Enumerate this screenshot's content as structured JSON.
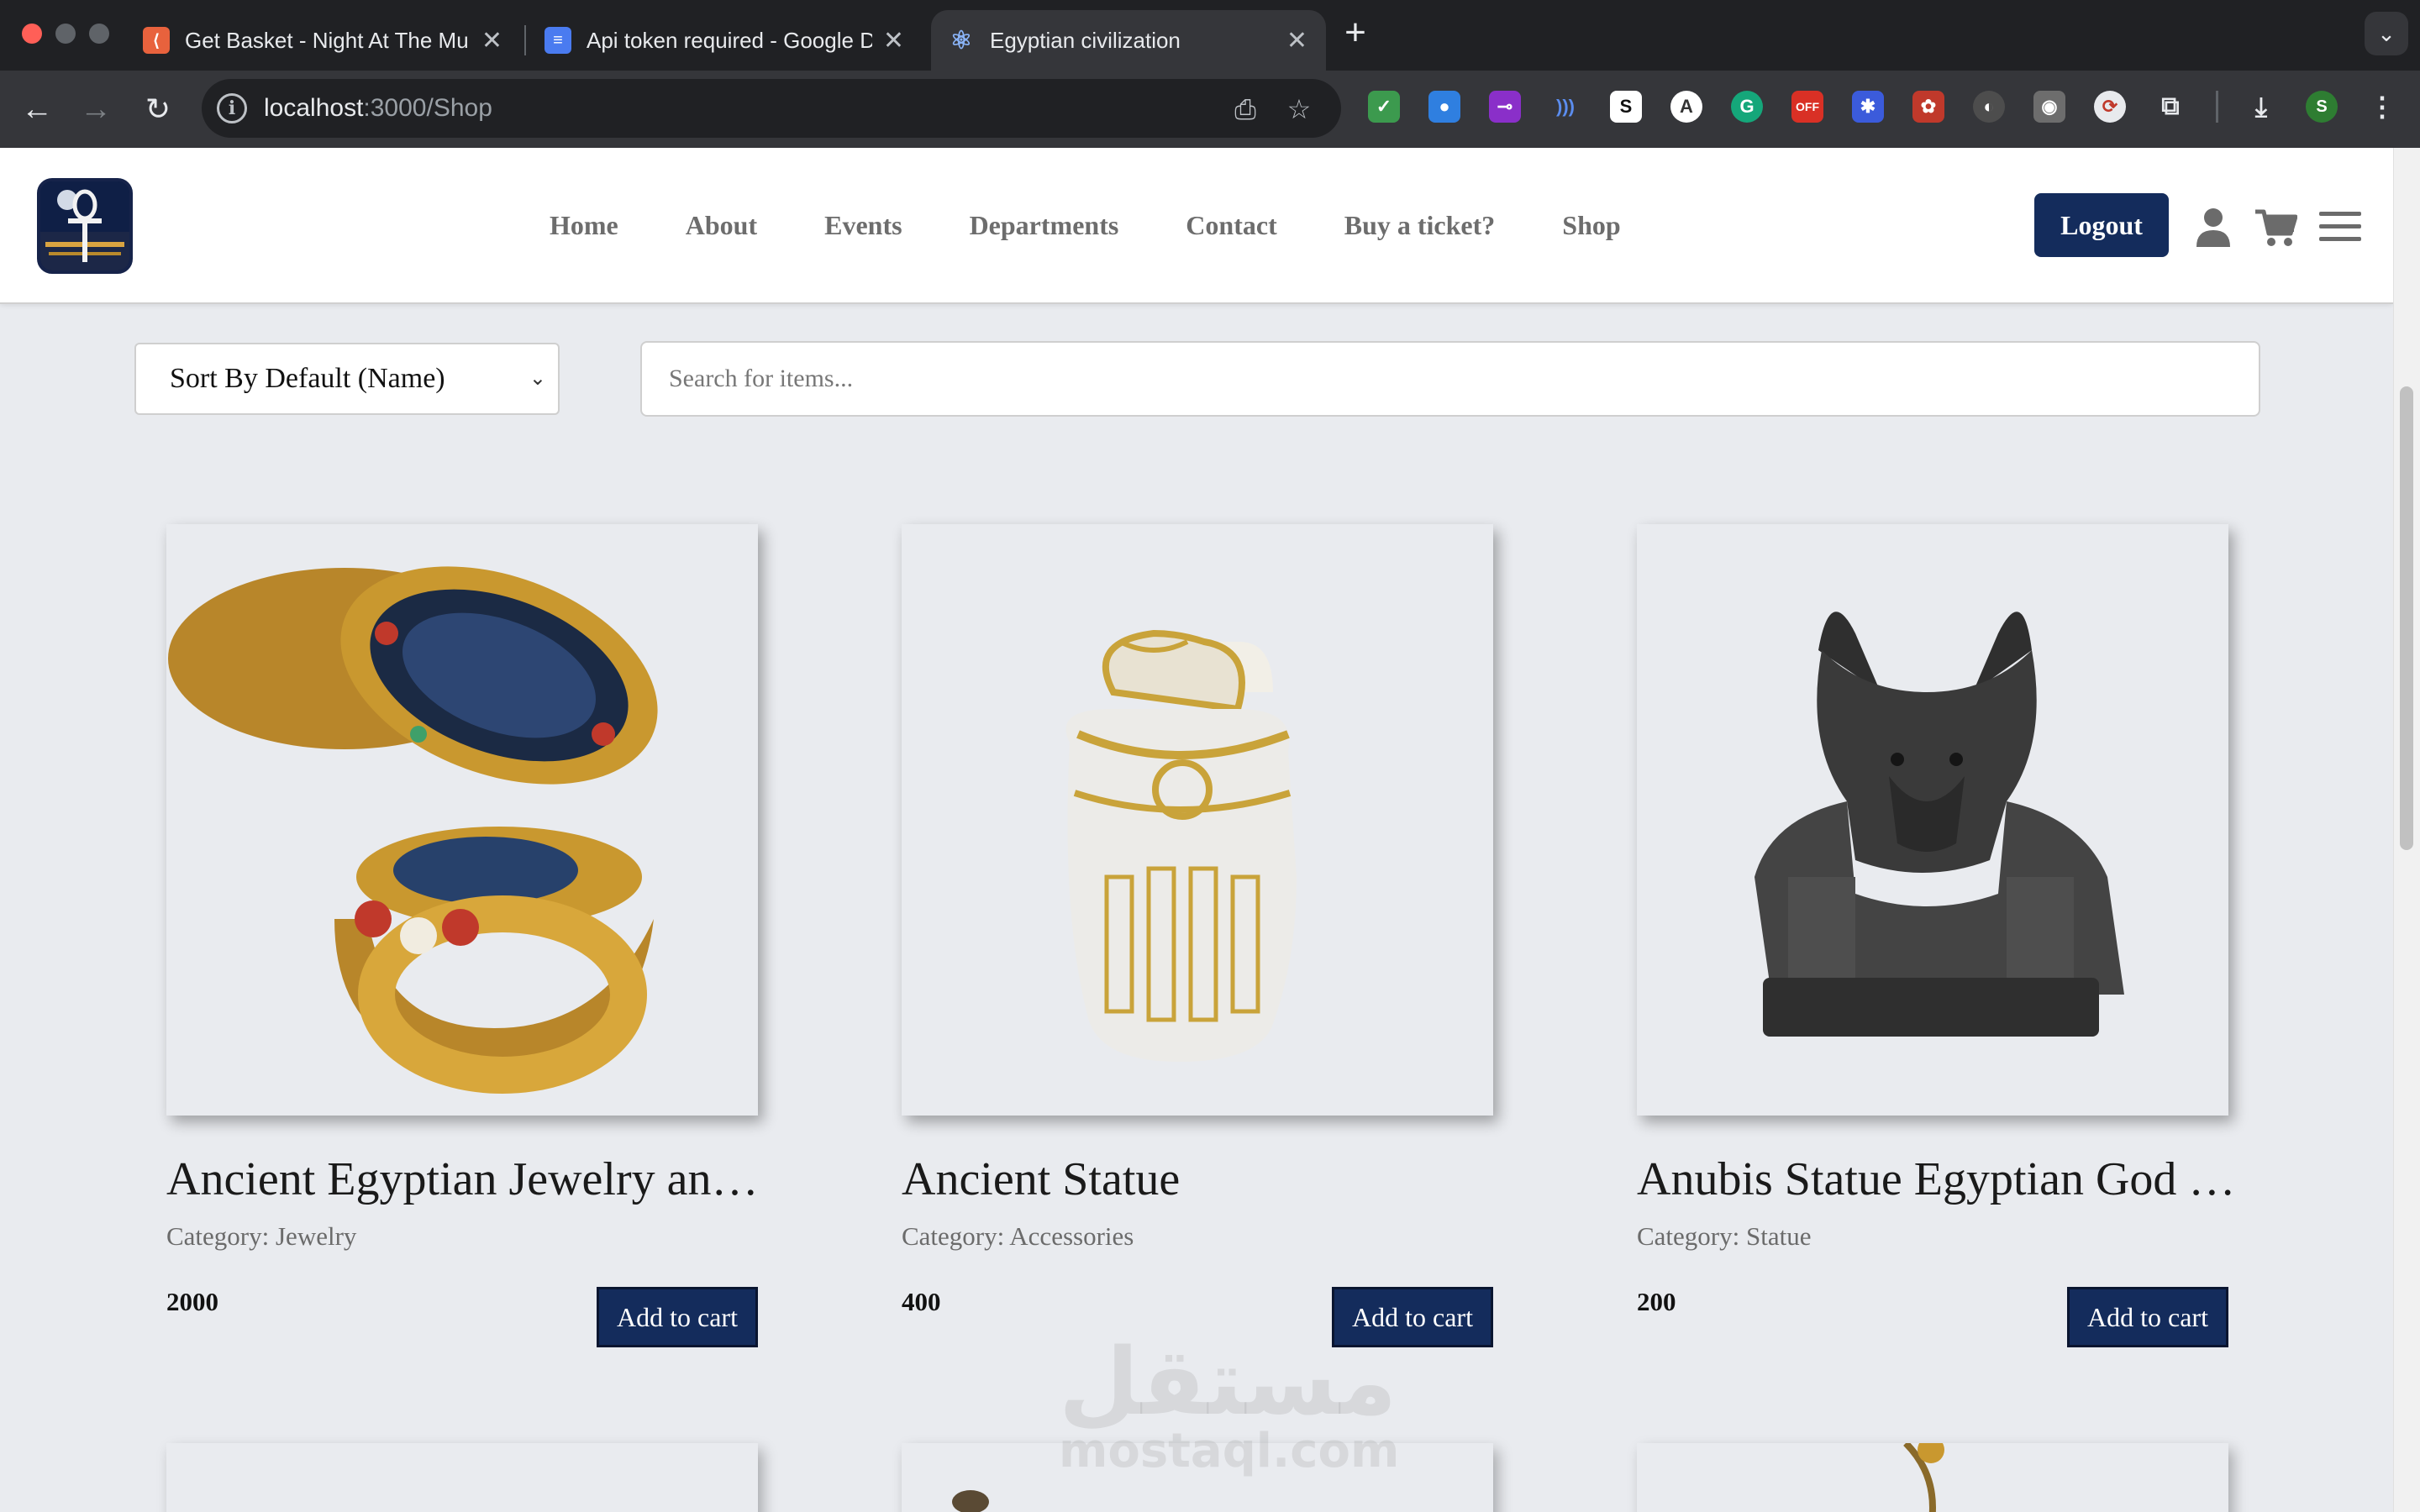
{
  "browser": {
    "tabs": [
      {
        "title": "Get Basket - Night At The Mu",
        "icon": "basket-favicon",
        "active": false
      },
      {
        "title": "Api token required - Google D",
        "icon": "google-docs-favicon",
        "active": false
      },
      {
        "title": "Egyptian civilization",
        "icon": "react-favicon",
        "active": true
      }
    ],
    "url_host": "localhost",
    "url_path": ":3000/Shop",
    "extensions": [
      "shield-ext",
      "drop-ext",
      "slider-ext",
      "wave-ext",
      "s-ext",
      "a-ext",
      "grammarly-ext",
      "off-ext",
      "snowflake-ext",
      "puzzle-ext",
      "gear-ext",
      "camera-ext",
      "sync-ext",
      "extensions-puzzle",
      "download",
      "profile-s",
      "menu"
    ],
    "profile_initial": "S",
    "off_badge": "OFF"
  },
  "site": {
    "nav": [
      "Home",
      "About",
      "Events",
      "Departments",
      "Contact",
      "Buy a ticket?",
      "Shop"
    ],
    "logout": "Logout"
  },
  "controls": {
    "sort_label": "Sort By Default (Name)",
    "search_placeholder": "Search for items..."
  },
  "products": [
    {
      "title": "Ancient Egyptian Jewelry an…",
      "category": "Category: Jewelry",
      "price": "2000",
      "button": "Add to cart"
    },
    {
      "title": "Ancient Statue",
      "category": "Category: Accessories",
      "price": "400",
      "button": "Add to cart"
    },
    {
      "title": "Anubis Statue Egyptian God …",
      "category": "Category: Statue",
      "price": "200",
      "button": "Add to cart"
    }
  ],
  "watermark": {
    "arabic": "مستقل",
    "latin": "mostaql.com"
  },
  "colors": {
    "accent": "#142c5c",
    "chrome_dark": "#202124",
    "chrome_toolbar": "#35363a",
    "page_bg": "#e9ebef"
  }
}
